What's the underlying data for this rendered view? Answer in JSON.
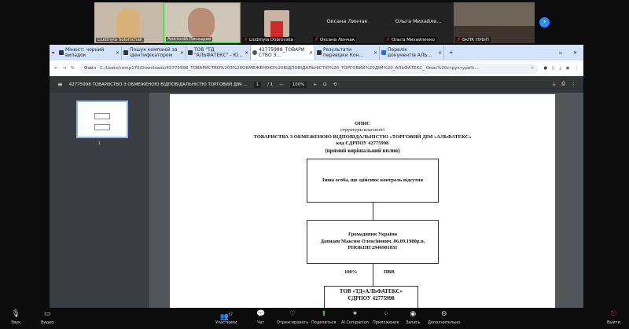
{
  "participants": [
    {
      "name": "Liudmyla Solomchak"
    },
    {
      "name": "Анатолій Пискарев"
    },
    {
      "name": "Liudmyla Dobrovska"
    },
    {
      "name": "Оксана Линчак",
      "display": "Оксана Линчак"
    },
    {
      "name": "Ольга Михайленко",
      "display": "Ольга  Михайле..."
    },
    {
      "name": "БкПК НУБіП"
    }
  ],
  "browser": {
    "tabs": [
      {
        "label": "Мінюст: чорний випадок",
        "close": "×"
      },
      {
        "label": "Пошук компаній за ідентифікатором",
        "close": "×"
      },
      {
        "label": "ТОВ \"ТД \"АЛЬФАТЕКС\" - Ю...",
        "close": "×"
      },
      {
        "label": "42775998_ТОВАРИСТВО З...",
        "close": "×"
      },
      {
        "label": "Результати перевірки Кон...",
        "close": "×"
      },
      {
        "label": "Перелік документів АЛЬ...",
        "close": "×"
      }
    ],
    "new_tab": "+",
    "file_label": "Файл",
    "url": "C:/Users/comp170/Downloads/42775998_ТОВАРИСТВО%20З%20ОБМЕЖЕНОЮ%20ВІДПОВІДАЛЬНІСТЮ%20_ТОРГОВИЙ%20ДІМ%20_АЛЬФАТЕКС_ Опис%20структури%..."
  },
  "pdf": {
    "title": "42775998 ТОВАРИСТВО З ОБМЕЖЕНОЮ ВІДПОВІДАЛЬНІСТЮ  ТОРГОВИЙ ДІМ ...",
    "page": "1",
    "total": "/ 1",
    "zoom": "100%",
    "thumb_label": "1",
    "doc": {
      "h1": "ОПИС",
      "h2": "структури власності",
      "h3": "ТОВАРИСТВА З ОБМЕЖЕНОЮ ВІДПОВІДАЛЬНІСТЮ «ТОРГОВИЙ ДІМ «АЛЬФАТЕКС»",
      "h4": "код ЄДРПОУ 42775998",
      "h5": "(прямий вирішальний вплив)",
      "box1": "Інша особа, що здійснює контроль відсутня",
      "box2_l1": "Громадянин України",
      "box2_l2": "Давидов Максим Олексійович, 06.09.1980р.н.",
      "box2_l3": "РНОКПП 2946901831",
      "share": "100%",
      "type": "ПВВ",
      "box3_l1": "ТОВ «ТД«АЛЬФАТЕКС»",
      "box3_l2": "ЄДРПОУ 42775998"
    }
  },
  "zoom_toolbar": {
    "audio": "Звук",
    "video": "Видео",
    "participants": "Участники",
    "participants_count": "57",
    "chat": "Чат",
    "react": "Отреагировать",
    "share": "Поделиться",
    "ai": "AI Companion",
    "apps": "Приложения",
    "record": "Запись",
    "more": "Дополнительно",
    "leave": "Выйти"
  }
}
